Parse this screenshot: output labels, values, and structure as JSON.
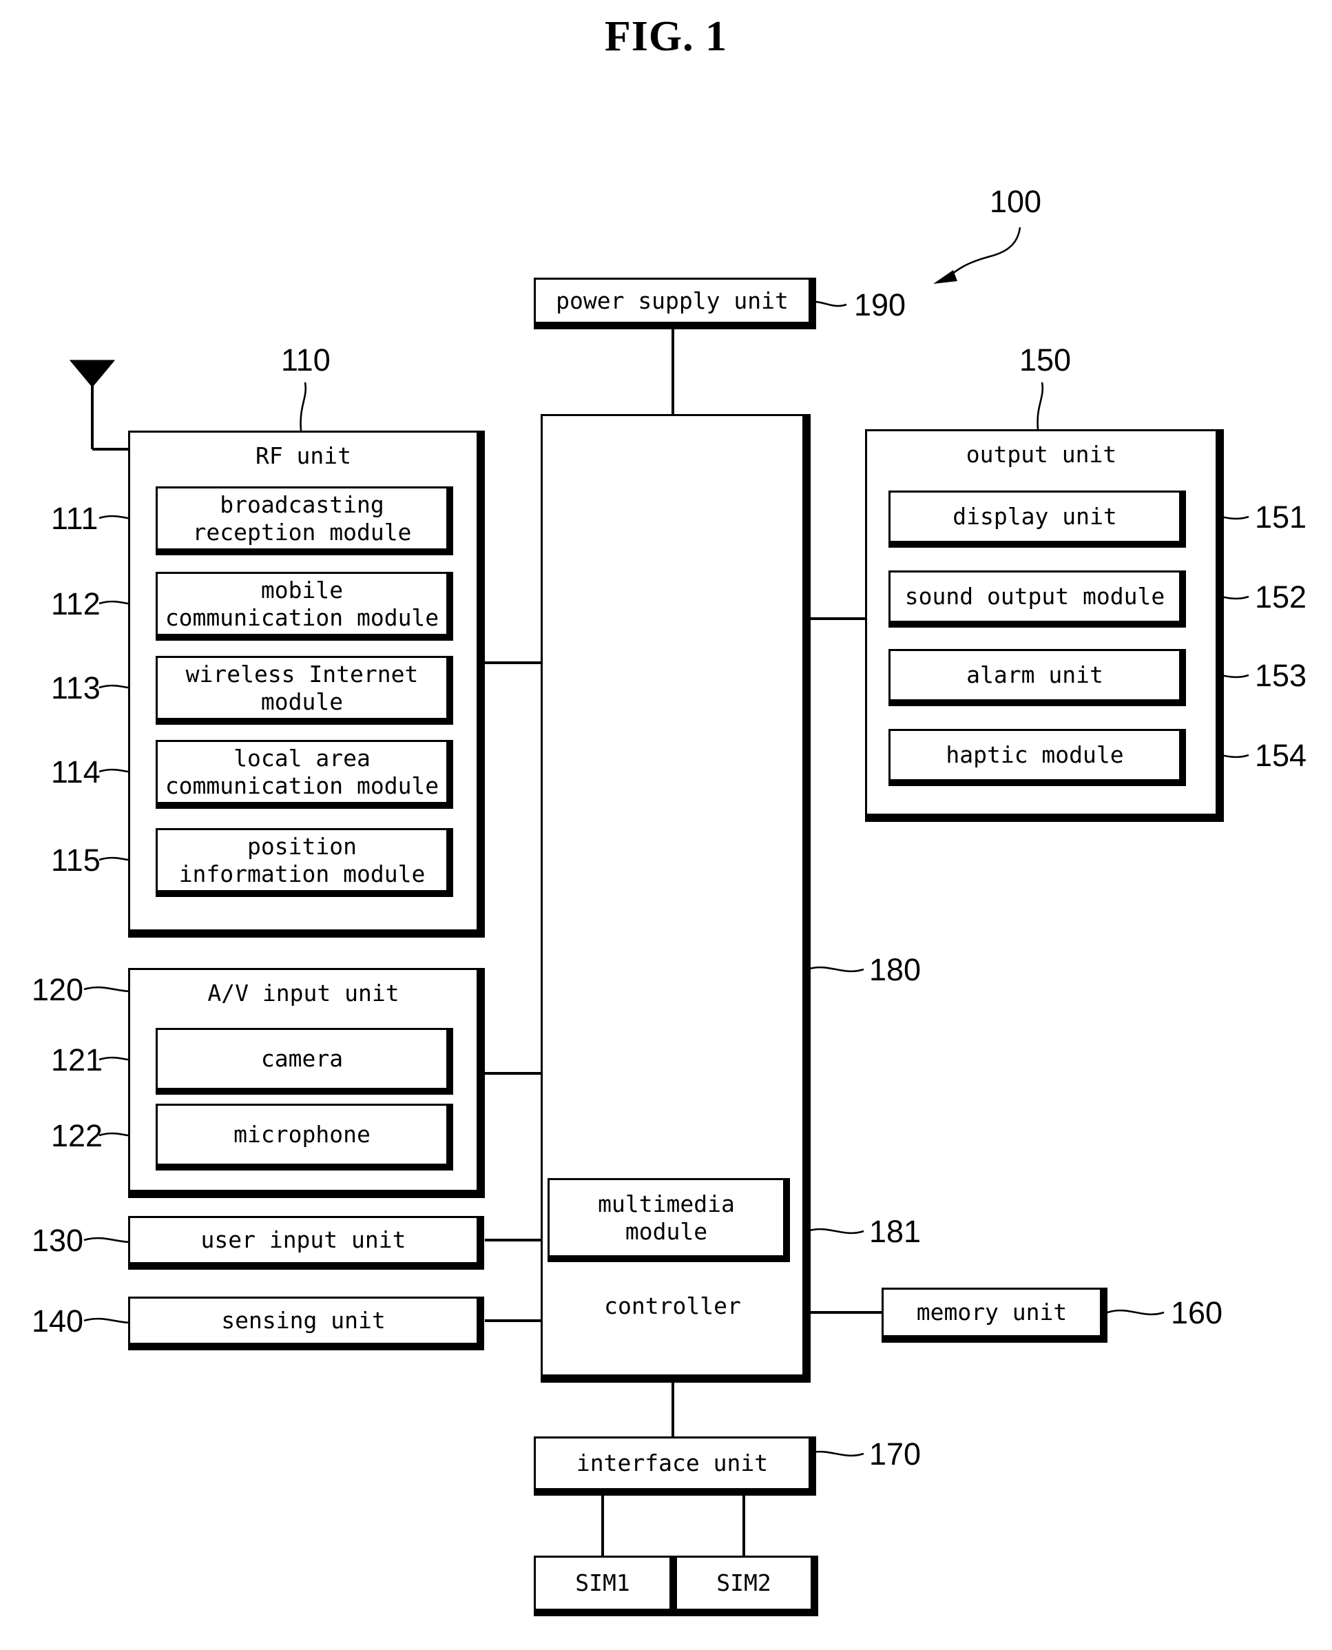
{
  "figure": {
    "title": "FIG. 1",
    "device_ref": "100"
  },
  "power_supply": {
    "label": "power supply unit",
    "ref": "190"
  },
  "rf_unit": {
    "label": "RF unit",
    "ref": "110",
    "modules": [
      {
        "label": "broadcasting\nreception module",
        "ref": "111"
      },
      {
        "label": "mobile\ncommunication module",
        "ref": "112"
      },
      {
        "label": "wireless Internet\nmodule",
        "ref": "113"
      },
      {
        "label": "local area\ncommunication module",
        "ref": "114"
      },
      {
        "label": "position\ninformation module",
        "ref": "115"
      }
    ]
  },
  "av_input_unit": {
    "label": "A/V input unit",
    "ref": "120",
    "modules": [
      {
        "label": "camera",
        "ref": "121"
      },
      {
        "label": "microphone",
        "ref": "122"
      }
    ]
  },
  "user_input_unit": {
    "label": "user input unit",
    "ref": "130"
  },
  "sensing_unit": {
    "label": "sensing unit",
    "ref": "140"
  },
  "output_unit": {
    "label": "output unit",
    "ref": "150",
    "modules": [
      {
        "label": "display unit",
        "ref": "151"
      },
      {
        "label": "sound output module",
        "ref": "152"
      },
      {
        "label": "alarm unit",
        "ref": "153"
      },
      {
        "label": "haptic module",
        "ref": "154"
      }
    ]
  },
  "controller": {
    "label": "controller",
    "ref": "180",
    "multimedia_module": {
      "label": "multimedia\nmodule",
      "ref": "181"
    }
  },
  "memory_unit": {
    "label": "memory unit",
    "ref": "160"
  },
  "interface_unit": {
    "label": "interface unit",
    "ref": "170"
  },
  "sim_cards": [
    {
      "label": "SIM1"
    },
    {
      "label": "SIM2"
    }
  ],
  "antenna": {
    "name": "antenna-symbol"
  },
  "colors": {
    "ink": "#000000",
    "paper": "#ffffff"
  }
}
